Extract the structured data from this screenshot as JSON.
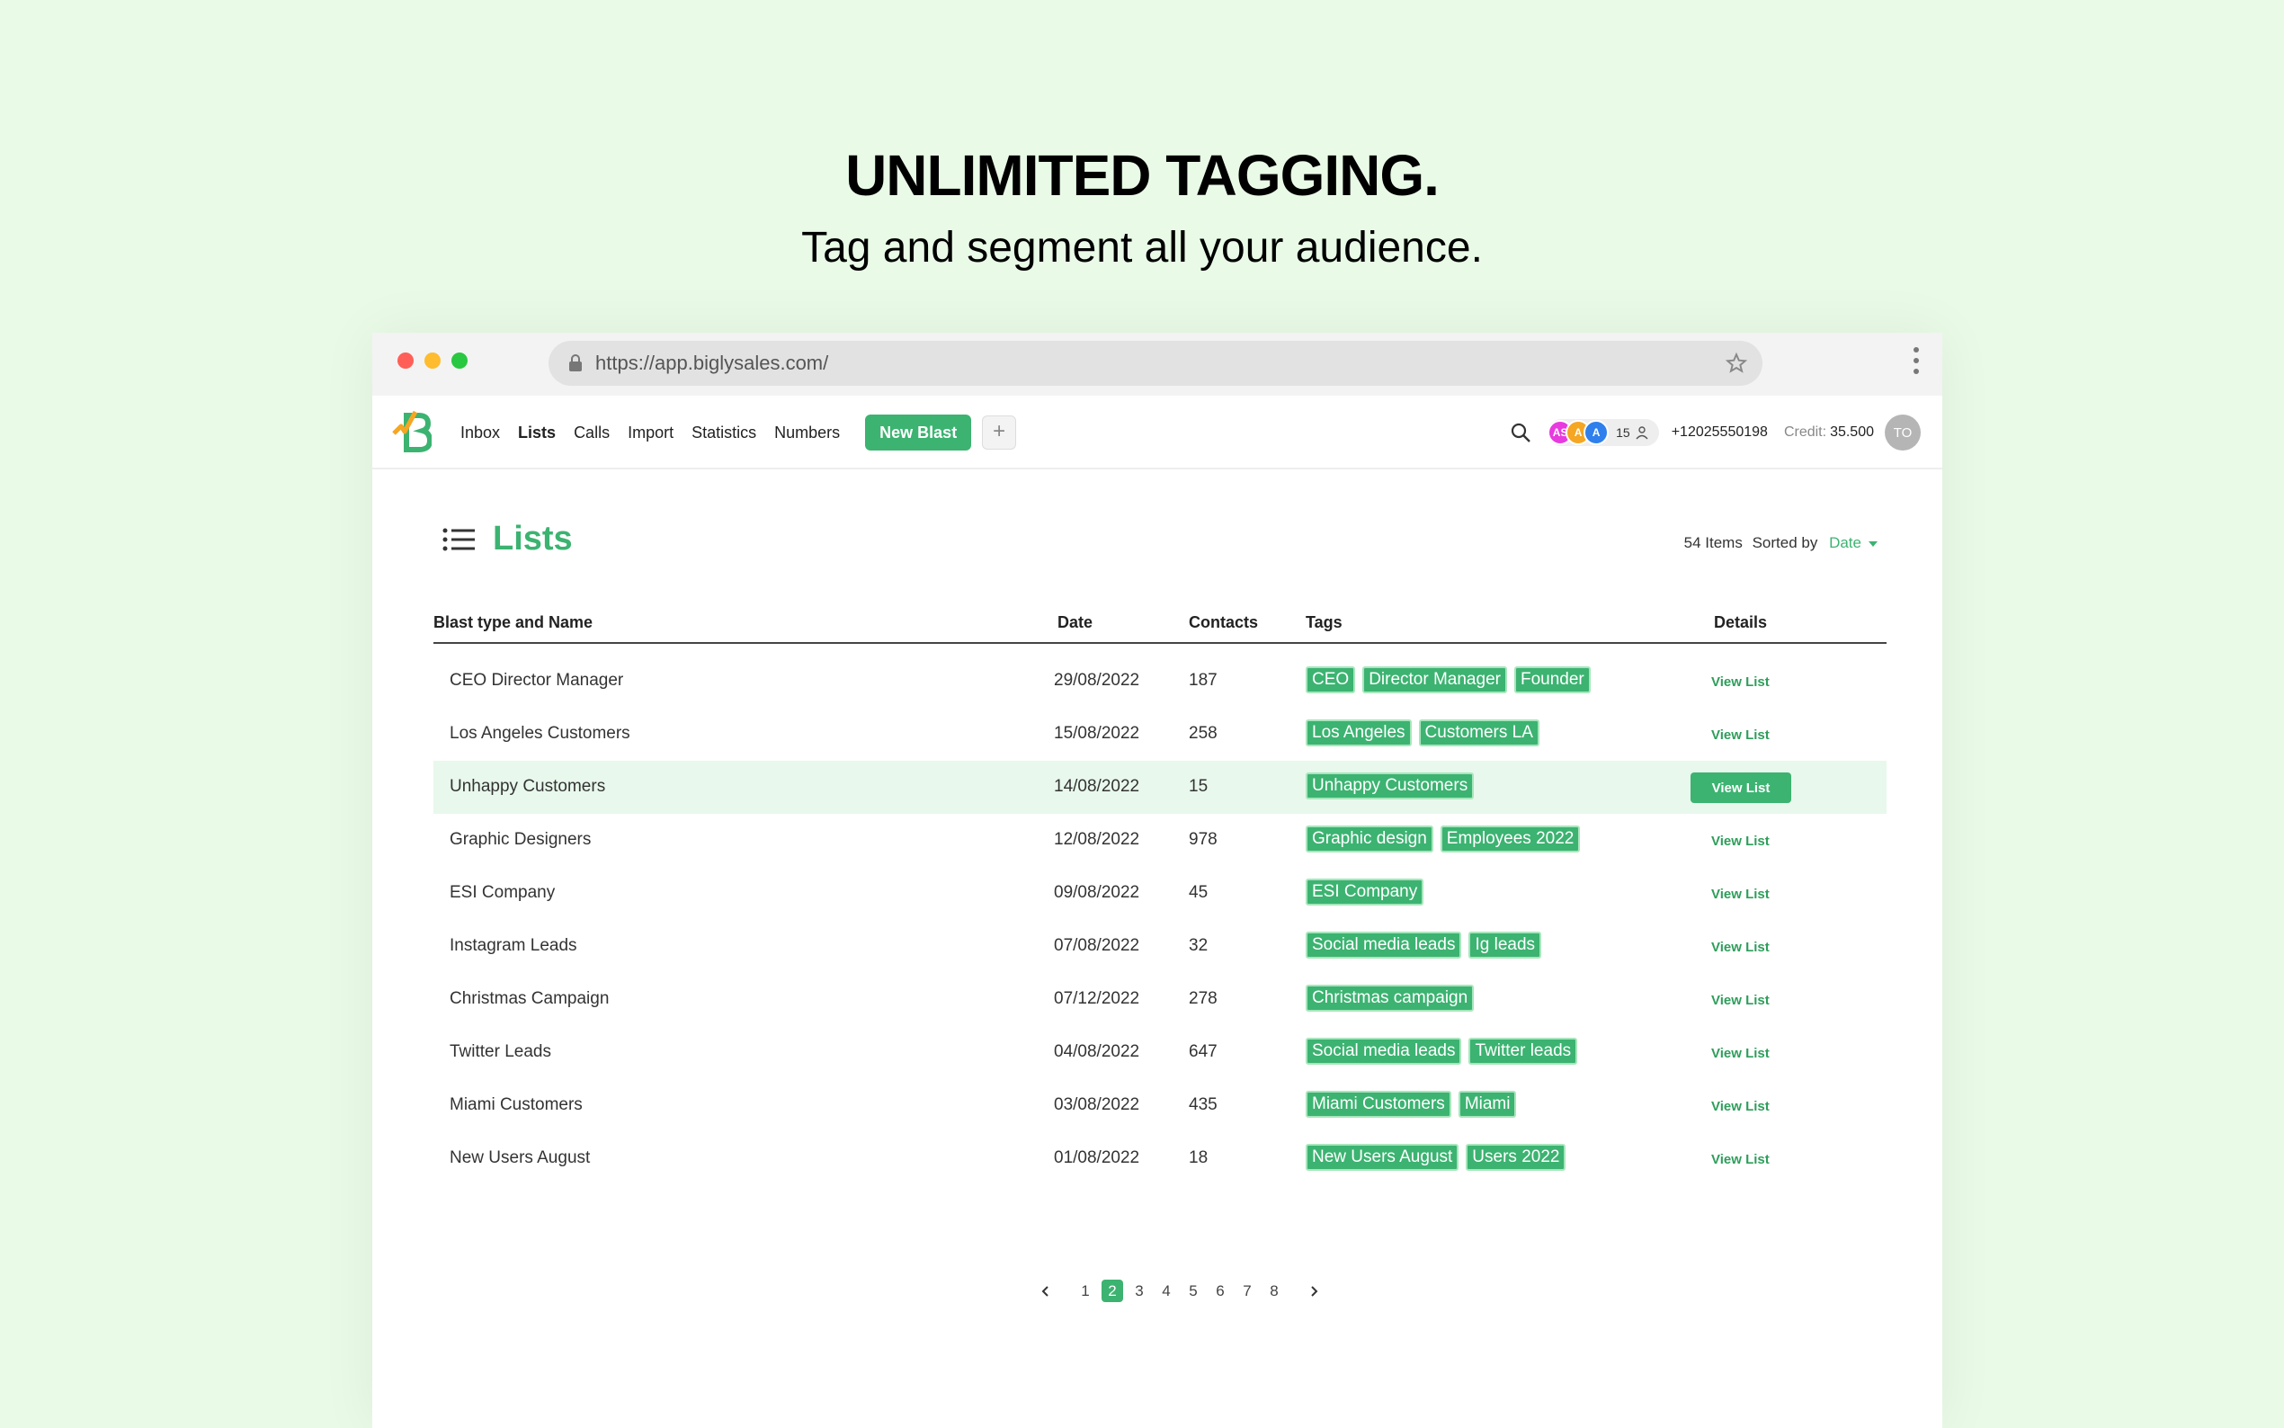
{
  "hero": {
    "title": "UNLIMITED TAGGING.",
    "subtitle": "Tag and segment all your audience."
  },
  "browser": {
    "url": "https://app.biglysales.com/"
  },
  "nav": {
    "links": [
      "Inbox",
      "Lists",
      "Calls",
      "Import",
      "Statistics",
      "Numbers"
    ],
    "active": "Lists",
    "new_blast": "New Blast",
    "plus": "+",
    "avatars": [
      {
        "initials": "AS",
        "color": "#e83adf"
      },
      {
        "initials": "A",
        "color": "#f5a623"
      },
      {
        "initials": "A",
        "color": "#2f80ed"
      }
    ],
    "avatar_count": "15",
    "phone": "+12025550198",
    "credit_label": "Credit:",
    "credit_value": "35.500",
    "profile": "TO"
  },
  "page": {
    "title": "Lists",
    "items_text": "54 Items",
    "sorted_by": "Sorted by",
    "sort_value": "Date"
  },
  "table": {
    "headers": {
      "name": "Blast type and Name",
      "date": "Date",
      "contacts": "Contacts",
      "tags": "Tags",
      "details": "Details"
    },
    "rows": [
      {
        "name": "CEO Director Manager",
        "date": "29/08/2022",
        "contacts": "187",
        "tags": [
          "CEO",
          "Director Manager",
          "Founder"
        ],
        "details": "View List"
      },
      {
        "name": "Los Angeles Customers",
        "date": "15/08/2022",
        "contacts": "258",
        "tags": [
          "Los Angeles",
          "Customers LA"
        ],
        "details": "View List"
      },
      {
        "name": "Unhappy Customers",
        "date": "14/08/2022",
        "contacts": "15",
        "tags": [
          "Unhappy Customers"
        ],
        "details": "View List"
      },
      {
        "name": "Graphic Designers",
        "date": "12/08/2022",
        "contacts": "978",
        "tags": [
          "Graphic design",
          "Employees 2022"
        ],
        "details": "View List"
      },
      {
        "name": "ESI Company",
        "date": "09/08/2022",
        "contacts": "45",
        "tags": [
          "ESI Company"
        ],
        "details": "View List"
      },
      {
        "name": "Instagram Leads",
        "date": "07/08/2022",
        "contacts": "32",
        "tags": [
          "Social media leads",
          "Ig leads"
        ],
        "details": "View List"
      },
      {
        "name": "Christmas Campaign",
        "date": "07/12/2022",
        "contacts": "278",
        "tags": [
          "Christmas campaign"
        ],
        "details": "View List"
      },
      {
        "name": "Twitter Leads",
        "date": "04/08/2022",
        "contacts": "647",
        "tags": [
          "Social media leads",
          "Twitter leads"
        ],
        "details": "View List"
      },
      {
        "name": "Miami Customers",
        "date": "03/08/2022",
        "contacts": "435",
        "tags": [
          "Miami Customers",
          "Miami"
        ],
        "details": "View List"
      },
      {
        "name": "New Users August",
        "date": "01/08/2022",
        "contacts": "18",
        "tags": [
          "New Users August",
          "Users 2022"
        ],
        "details": "View List"
      }
    ],
    "highlighted_row": 2
  },
  "pagination": {
    "pages": [
      "1",
      "2",
      "3",
      "4",
      "5",
      "6",
      "7",
      "8"
    ],
    "current": "2"
  },
  "colors": {
    "accent": "#3cb371",
    "background": "#e9fbe7",
    "highlight_row": "#e8f8ec"
  }
}
